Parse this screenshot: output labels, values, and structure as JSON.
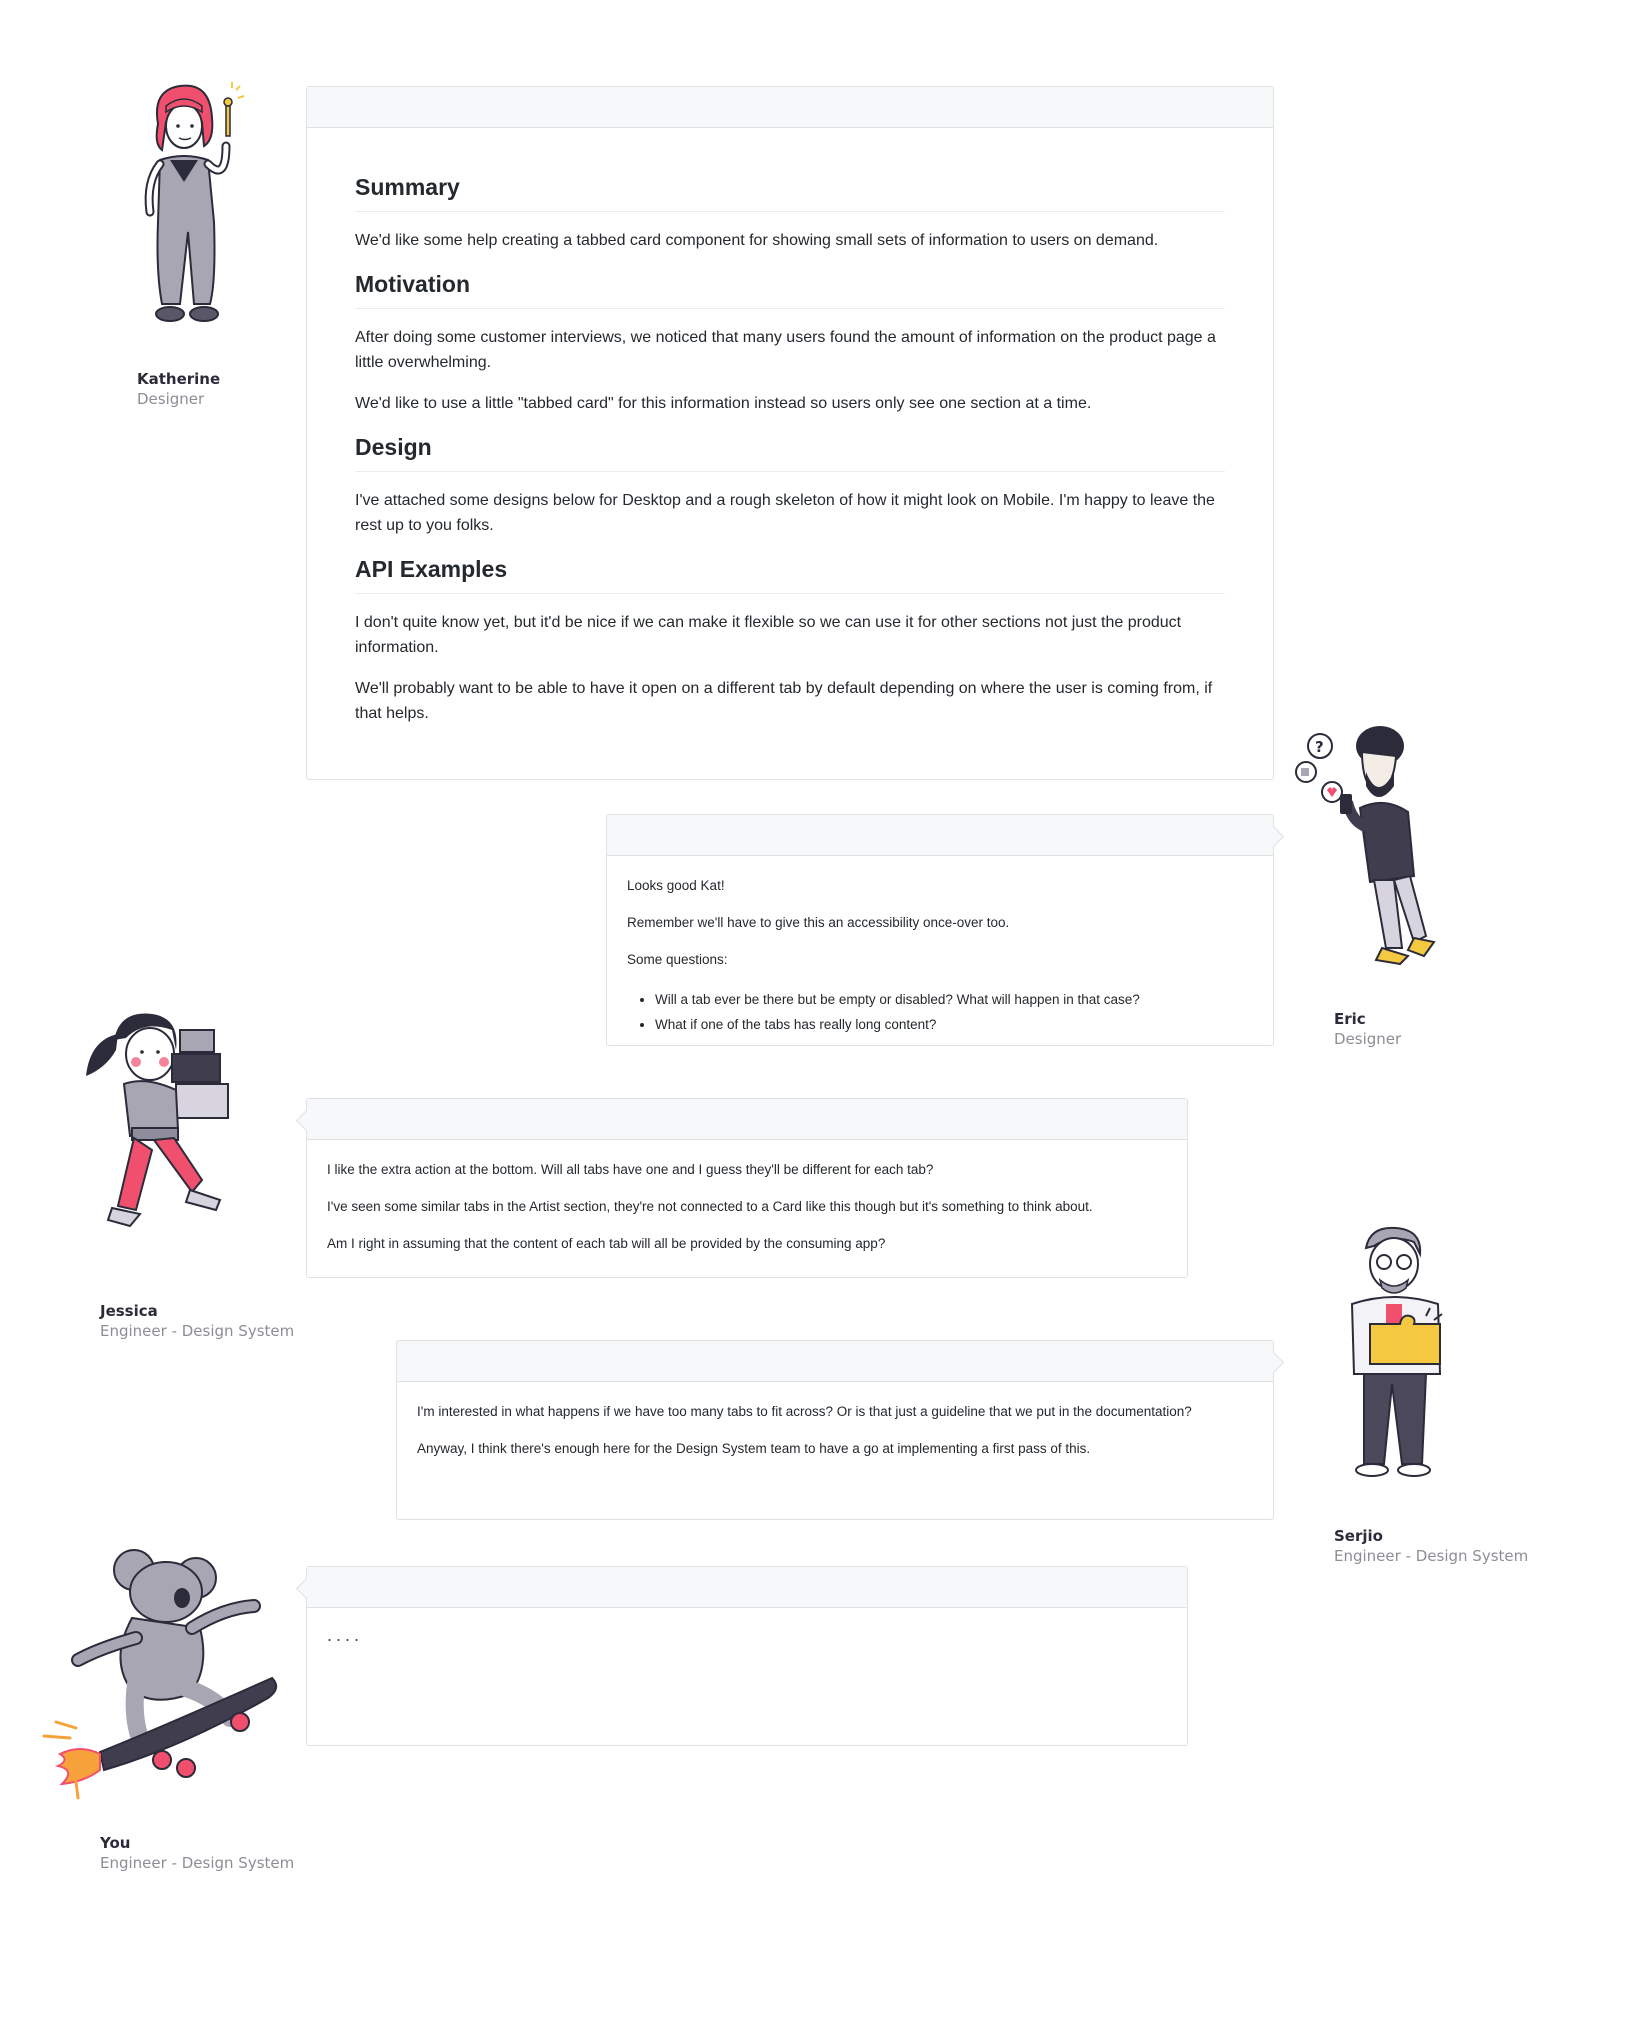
{
  "main_card": {
    "sections": [
      {
        "heading": "Summary",
        "paragraphs": [
          "We'd like some help creating a tabbed card component for showing small sets of information to users on demand."
        ]
      },
      {
        "heading": "Motivation",
        "paragraphs": [
          "After doing some customer interviews, we noticed that many users found the amount of information on the product page a little overwhelming.",
          "We'd like to use a little \"tabbed card\" for this information instead so users only see one section at a time."
        ]
      },
      {
        "heading": "Design",
        "paragraphs": [
          "I've attached some designs below for Desktop and a rough skeleton of how it might look on Mobile. I'm happy to leave the rest up to you folks."
        ]
      },
      {
        "heading": "API Examples",
        "paragraphs": [
          "I don't quite know yet, but it'd be nice if we can make it flexible so we can use it for other sections not just the product information.",
          "We'll probably want to be able to have it open on a different tab by default depending on where the user is coming from, if that helps."
        ]
      }
    ]
  },
  "people": {
    "katherine": {
      "name": "Katherine",
      "role": "Designer"
    },
    "eric": {
      "name": "Eric",
      "role": "Designer"
    },
    "jessica": {
      "name": "Jessica",
      "role": "Engineer - Design System"
    },
    "serjio": {
      "name": "Serjio",
      "role": "Engineer - Design System"
    },
    "you": {
      "name": "You",
      "role": "Engineer - Design System"
    }
  },
  "comments": {
    "eric": {
      "paragraphs": [
        "Looks good Kat!",
        "Remember we'll have to give this an accessibility once-over too.",
        "Some questions:"
      ],
      "bullets": [
        "Will a tab ever be there but be empty or disabled? What will happen in that case?",
        "What if one of the tabs has really long content?"
      ]
    },
    "jessica": {
      "paragraphs": [
        "I like the extra action at the bottom. Will all tabs have one and I guess they'll be different for each tab?",
        "I've seen some similar tabs in the Artist section, they're not connected to a Card like this though but it's something to think about.",
        "Am I right in assuming that the content of each tab will all be provided by the consuming app?"
      ]
    },
    "serjio": {
      "paragraphs": [
        "I'm interested in what happens if we have too many tabs to fit across? Or is that just a guideline that we put in the documentation?",
        "Anyway, I think there's enough here for the Design System team to have a go at implementing a first pass of this."
      ]
    },
    "you": {
      "placeholder": "...."
    }
  },
  "icons": {
    "katherine": "woman-holding-key-illustration",
    "eric": "man-with-phone-illustration",
    "jessica": "girl-carrying-boxes-illustration",
    "serjio": "man-holding-puzzle-illustration",
    "you": "koala-rocket-skateboard-illustration"
  },
  "colors": {
    "accent_pink": "#f0506e",
    "accent_yellow": "#f5c842",
    "figure_gray": "#a9a6b4",
    "outline": "#2b2b3a"
  }
}
